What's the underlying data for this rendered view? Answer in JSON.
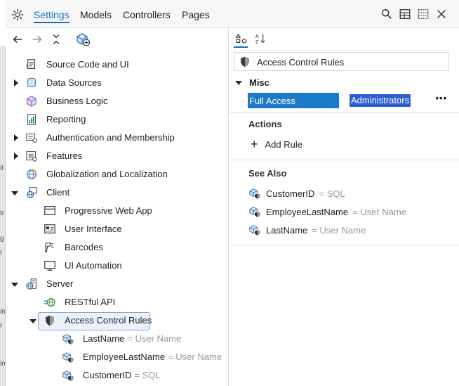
{
  "tabs": [
    "Settings",
    "Models",
    "Controllers",
    "Pages"
  ],
  "background_window_fragments": [
    "it",
    "tr",
    "g",
    "r",
    "in",
    "r",
    "in"
  ],
  "tree": [
    {
      "label": "Source Code and UI",
      "icon": "source-code-icon",
      "indent": 0,
      "arrow": "none"
    },
    {
      "label": "Data Sources",
      "icon": "database-icon",
      "indent": 0,
      "arrow": "collapsed"
    },
    {
      "label": "Business Logic",
      "icon": "cube-icon",
      "indent": 0,
      "arrow": "none"
    },
    {
      "label": "Reporting",
      "icon": "report-icon",
      "indent": 0,
      "arrow": "none"
    },
    {
      "label": "Authentication and Membership",
      "icon": "auth-icon",
      "indent": 0,
      "arrow": "collapsed"
    },
    {
      "label": "Features",
      "icon": "features-icon",
      "indent": 0,
      "arrow": "collapsed"
    },
    {
      "label": "Globalization and Localization",
      "icon": "globe-icon",
      "indent": 0,
      "arrow": "none"
    },
    {
      "label": "Client",
      "icon": "client-globe-icon",
      "indent": 0,
      "arrow": "expanded"
    },
    {
      "label": "Progressive Web App",
      "icon": "window-icon",
      "indent": 1,
      "arrow": "none"
    },
    {
      "label": "User Interface",
      "icon": "ui-card-icon",
      "indent": 1,
      "arrow": "none"
    },
    {
      "label": "Barcodes",
      "icon": "barcode-scanner-icon",
      "indent": 1,
      "arrow": "none"
    },
    {
      "label": "UI Automation",
      "icon": "monitor-icon",
      "indent": 1,
      "arrow": "none"
    },
    {
      "label": "Server",
      "icon": "server-globe-icon",
      "indent": 0,
      "arrow": "expanded"
    },
    {
      "label": "RESTful API",
      "icon": "api-globe-icon",
      "indent": 1,
      "arrow": "none"
    },
    {
      "label": "Access Control Rules",
      "icon": "shield-icon",
      "indent": 1,
      "arrow": "expanded",
      "selected": true
    },
    {
      "label": "LastName",
      "sub": "= User Name",
      "icon": "shielded-cube-icon",
      "indent": 2,
      "arrow": "none"
    },
    {
      "label": "EmployeeLastName",
      "sub": "= User Name",
      "icon": "shielded-cube-icon",
      "indent": 2,
      "arrow": "none"
    },
    {
      "label": "CustomerID",
      "sub": "= SQL",
      "icon": "shielded-cube-icon",
      "indent": 2,
      "arrow": "none"
    }
  ],
  "properties": {
    "title": "Access Control Rules",
    "misc_header": "Misc",
    "misc_key": "Full Access",
    "misc_value": "Administrators",
    "more": "•••",
    "actions_header": "Actions",
    "add_rule": "Add Rule",
    "see_also_header": "See Also",
    "see_also": [
      {
        "label": "CustomerID",
        "sub": "= SQL"
      },
      {
        "label": "EmployeeLastName",
        "sub": "= User Name"
      },
      {
        "label": "LastName",
        "sub": "= User Name"
      }
    ]
  },
  "colors": {
    "accent": "#1a6fc4",
    "selection": "#1a79c9",
    "value_highlight": "#2b5fd1"
  }
}
